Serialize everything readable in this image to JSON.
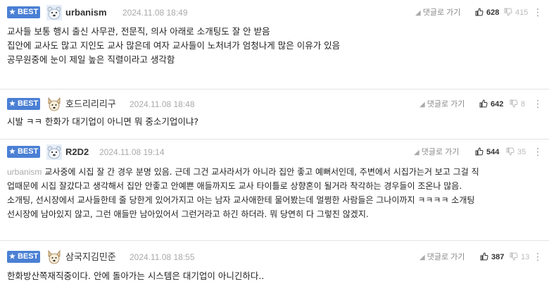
{
  "colors": {
    "best_badge": "#4a7fd4",
    "divider": "#e3e3e3",
    "muted": "#aaaaaa"
  },
  "best_label": "BEST",
  "reply_label": "댓글로 가기",
  "comments": [
    {
      "avatar_icon": "polar-bear-avatar-icon",
      "nickname": "urbanism",
      "date": "2024.11.08 18:49",
      "upvotes": "628",
      "downvotes": "415",
      "lines": [
        "교사들 보통 행시 출신 사무관, 전문직, 의사 아래로 소개팅도 잘 안 받음",
        "집안에 교사도 많고 지인도 교사 많은데 여자 교사들이 노처녀가 엄청나게 많은 이유가 있음",
        "",
        "공무원중에 눈이 제일 높은 직렬이라고 생각함"
      ]
    },
    {
      "avatar_icon": "dog-avatar-icon",
      "nickname": "호드리리리구",
      "date": "2024.11.08 18:48",
      "upvotes": "642",
      "downvotes": "8",
      "lines": [
        "시발 ㅋㅋ 한화가 대기업이 아니면 뭐 중소기업이냐?"
      ]
    },
    {
      "avatar_icon": "polar-bear-avatar-icon",
      "nickname": "R2D2",
      "date": "2024.11.08 19:14",
      "upvotes": "544",
      "downvotes": "35",
      "mention": "urbanism",
      "lines": [
        "교사중에 시집 잘 간 경우 분명 있음. 근데 그건 교사라서가 아니라 집안 좋고 예뻐서인데, 주변에서 시집가는거 보고 그걸 직",
        "업때문에 시집 잘갔다고 생각해서 집안 안좋고 안예쁜 애들까지도 교사 타이틀로 상향혼이 될거라 착각하는 경우들이 조온나 많음.",
        "",
        "소개팅, 선시장에서 교사들한테 줄 당한게 있어가지고 아는 남자 교사애한테 물어봤는데 멀쩡한 사람들은 그나이까지 ㅋㅋㅋㅋ 소개팅",
        "선시장에 남아있지 않고, 그런 애들만 남아있어서 그런거라고 하긴 하더라. 뭐 당연히 다 그렇진 않겠지."
      ]
    },
    {
      "avatar_icon": "dog-avatar-icon",
      "nickname": "삼국지김민준",
      "date": "2024.11.08 18:55",
      "upvotes": "387",
      "downvotes": "13",
      "lines": [
        "한화방산쪽재직중이다. 안에 돌아가는 시스템은 대기업이 아니긴하다.."
      ]
    }
  ]
}
